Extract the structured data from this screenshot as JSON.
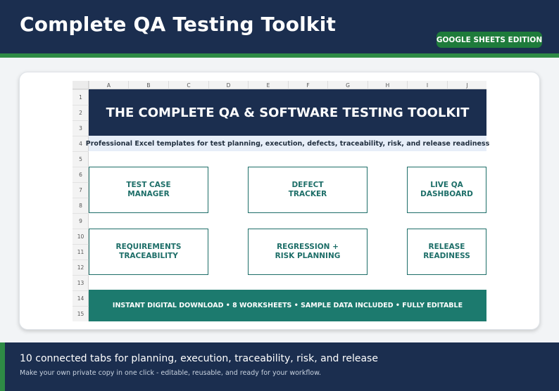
{
  "header": {
    "title": "Complete QA Testing Toolkit",
    "badge": "GOOGLE SHEETS EDITION"
  },
  "sheet": {
    "columns": [
      "A",
      "B",
      "C",
      "D",
      "E",
      "F",
      "G",
      "H",
      "I",
      "J"
    ],
    "rows": [
      "1",
      "2",
      "3",
      "4",
      "5",
      "6",
      "7",
      "8",
      "9",
      "10",
      "11",
      "12",
      "13",
      "14",
      "15"
    ],
    "title": "THE COMPLETE QA & SOFTWARE TESTING TOOLKIT",
    "subtitle": "Professional Excel templates for test planning, execution, defects, traceability, risk, and release readiness",
    "tiles": [
      {
        "line1": "TEST CASE",
        "line2": "MANAGER"
      },
      {
        "line1": "DEFECT",
        "line2": "TRACKER"
      },
      {
        "line1": "LIVE QA",
        "line2": "DASHBOARD"
      },
      {
        "line1": "REQUIREMENTS",
        "line2": "TRACEABILITY"
      },
      {
        "line1": "REGRESSION +",
        "line2": "RISK PLANNING"
      },
      {
        "line1": "RELEASE",
        "line2": "READINESS"
      }
    ],
    "footer": "INSTANT DIGITAL DOWNLOAD  •  8 WORKSHEETS  •  SAMPLE DATA INCLUDED  •  FULLY EDITABLE"
  },
  "bottom": {
    "headline": "10 connected tabs for planning, execution, traceability, risk, and release",
    "subline": "Make your own private copy in one click - editable, reusable, and ready for your workflow."
  },
  "colors": {
    "navy": "#1b2e4f",
    "green": "#2e8b45",
    "teal": "#1c7a6e",
    "tile_border": "#1d6e68"
  }
}
